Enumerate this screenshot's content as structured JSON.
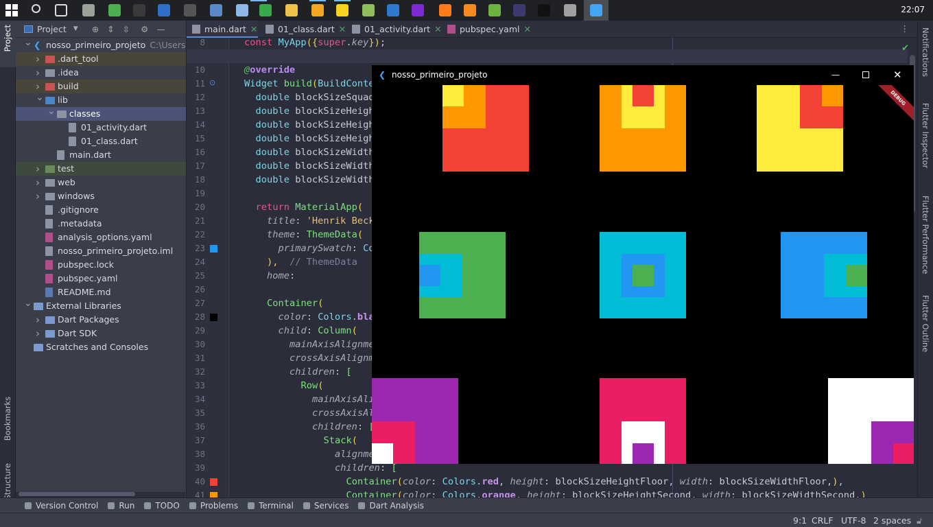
{
  "taskbar": {
    "clock": "22:07",
    "icons": [
      {
        "name": "windows-start-icon",
        "color": "#ffffff"
      },
      {
        "name": "search-icon",
        "color": "#dddddd"
      },
      {
        "name": "task-view-icon",
        "color": "#dddddd"
      },
      {
        "name": "recycle-bin-icon",
        "color": "#9aa29a"
      },
      {
        "name": "git-icon",
        "color": "#4caf50"
      },
      {
        "name": "cmd-icon",
        "color": "#3a3a3a"
      },
      {
        "name": "powershell-icon",
        "color": "#2f6fc7"
      },
      {
        "name": "terminal-icon",
        "color": "#555555"
      },
      {
        "name": "virtualbox-icon",
        "color": "#5a88c8"
      },
      {
        "name": "app-icon",
        "color": "#8fb7e8"
      },
      {
        "name": "cheat-engine-icon",
        "color": "#3ba84a"
      },
      {
        "name": "file-explorer-icon",
        "color": "#f0c24a"
      },
      {
        "name": "folder-icon",
        "color": "#f5a623"
      },
      {
        "name": "sticky-notes-icon",
        "color": "#f7d21e"
      },
      {
        "name": "app-green-icon",
        "color": "#8fbf5a"
      },
      {
        "name": "thunderbird-icon",
        "color": "#2e7ad1"
      },
      {
        "name": "app-purple-icon",
        "color": "#7b2ad4"
      },
      {
        "name": "firefox-icon",
        "color": "#ff7a18"
      },
      {
        "name": "app-orange-icon",
        "color": "#f58a1f"
      },
      {
        "name": "spring-icon",
        "color": "#6db33f"
      },
      {
        "name": "eclipse-icon",
        "color": "#3c3a6e"
      },
      {
        "name": "intellij-icon",
        "color": "#111111"
      },
      {
        "name": "usb-icon",
        "color": "#a0a0a0"
      },
      {
        "name": "flutter-icon",
        "color": "#42a5f5"
      }
    ]
  },
  "left_strip": {
    "project": "Project",
    "bookmarks": "Bookmarks",
    "structure": "Structure"
  },
  "right_strip": {
    "notifications": "Notifications",
    "inspector": "Flutter Inspector",
    "performance": "Flutter Performance",
    "outline": "Flutter Outline"
  },
  "project_panel": {
    "title": "Project",
    "tree": [
      {
        "label": "nosso_primeiro_projeto",
        "path": "C:\\Users\\F",
        "level": 0,
        "arrow": "open",
        "icon": "flutter",
        "color": "#42a5f5"
      },
      {
        "label": ".dart_tool",
        "level": 1,
        "arrow": "closed",
        "icon": "folder",
        "color": "#c75450",
        "bg": "#4a4539"
      },
      {
        "label": ".idea",
        "level": 1,
        "arrow": "closed",
        "icon": "folder",
        "color": "#8e93a1"
      },
      {
        "label": "build",
        "level": 1,
        "arrow": "closed",
        "icon": "folder",
        "color": "#c75450",
        "bg": "#4a4539"
      },
      {
        "label": "lib",
        "level": 1,
        "arrow": "open",
        "icon": "folder",
        "color": "#4a86c8"
      },
      {
        "label": "classes",
        "level": 2,
        "arrow": "open",
        "icon": "folder",
        "color": "#8e93a1",
        "bg": "#4b5478",
        "bold": true
      },
      {
        "label": "01_activity.dart",
        "level": 3,
        "icon": "file",
        "color": "#8e93a1"
      },
      {
        "label": "01_class.dart",
        "level": 3,
        "icon": "file",
        "color": "#8e93a1"
      },
      {
        "label": "main.dart",
        "level": 2,
        "icon": "file",
        "color": "#8e93a1"
      },
      {
        "label": "test",
        "level": 1,
        "arrow": "closed",
        "icon": "folder",
        "color": "#6a8a5a",
        "bg": "#3d4a3c"
      },
      {
        "label": "web",
        "level": 1,
        "arrow": "closed",
        "icon": "folder",
        "color": "#8e93a1"
      },
      {
        "label": "windows",
        "level": 1,
        "arrow": "closed",
        "icon": "folder",
        "color": "#8e93a1"
      },
      {
        "label": ".gitignore",
        "level": 1,
        "icon": "file",
        "color": "#8e93a1"
      },
      {
        "label": ".metadata",
        "level": 1,
        "icon": "file",
        "color": "#8e93a1"
      },
      {
        "label": "analysis_options.yaml",
        "level": 1,
        "icon": "file",
        "color": "#b0508a"
      },
      {
        "label": "nosso_primeiro_projeto.iml",
        "level": 1,
        "icon": "file",
        "color": "#8e93a1"
      },
      {
        "label": "pubspec.lock",
        "level": 1,
        "icon": "file",
        "color": "#b0508a"
      },
      {
        "label": "pubspec.yaml",
        "level": 1,
        "icon": "file",
        "color": "#b0508a"
      },
      {
        "label": "README.md",
        "level": 1,
        "icon": "file",
        "color": "#5a7ab0"
      },
      {
        "label": "External Libraries",
        "level": 0,
        "arrow": "open",
        "icon": "library",
        "color": "#7a9ad0"
      },
      {
        "label": "Dart Packages",
        "level": 1,
        "arrow": "closed",
        "icon": "library",
        "color": "#7a9ad0"
      },
      {
        "label": "Dart SDK",
        "level": 1,
        "arrow": "closed",
        "icon": "library",
        "color": "#7a9ad0"
      },
      {
        "label": "Scratches and Consoles",
        "level": 0,
        "icon": "scratch",
        "color": "#7a9ad0"
      }
    ]
  },
  "editor": {
    "tabs": [
      {
        "label": "main.dart",
        "active": true
      },
      {
        "label": "01_class.dart"
      },
      {
        "label": "01_activity.dart"
      },
      {
        "label": "pubspec.yaml"
      }
    ],
    "current_line": 9,
    "gutter_markers": {
      "23": "#2196f3",
      "28": "#000000",
      "40": "#f44336",
      "41": "#ff9800"
    },
    "lines": [
      {
        "n": 8,
        "indent": 0,
        "tokens": [
          [
            "const ",
            "kw"
          ],
          [
            "MyApp",
            "ty"
          ],
          [
            "({",
            "br"
          ],
          [
            "super",
            "kw"
          ],
          [
            ".",
            "plain"
          ],
          [
            "key",
            "prop"
          ],
          [
            "})",
            "br"
          ],
          [
            ";",
            "plain"
          ]
        ]
      },
      {
        "n": 9,
        "indent": 0,
        "tokens": []
      },
      {
        "n": 10,
        "indent": 0,
        "tokens": [
          [
            "@",
            "at"
          ],
          [
            "override",
            "ann"
          ]
        ]
      },
      {
        "n": 11,
        "indent": 0,
        "tokens": [
          [
            "Widget ",
            "ty"
          ],
          [
            "build",
            "fn"
          ],
          [
            "(",
            "br"
          ],
          [
            "BuildConte",
            "ty"
          ]
        ]
      },
      {
        "n": 12,
        "indent": 2,
        "tokens": [
          [
            "double ",
            "ty"
          ],
          [
            "blockSizeSquad",
            "plain"
          ]
        ]
      },
      {
        "n": 13,
        "indent": 2,
        "tokens": [
          [
            "double ",
            "ty"
          ],
          [
            "blockSizeHeigh",
            "plain"
          ]
        ]
      },
      {
        "n": 14,
        "indent": 2,
        "tokens": [
          [
            "double ",
            "ty"
          ],
          [
            "blockSizeHeigh",
            "plain"
          ]
        ]
      },
      {
        "n": 15,
        "indent": 2,
        "tokens": [
          [
            "double ",
            "ty"
          ],
          [
            "blockSizeHeigh",
            "plain"
          ]
        ]
      },
      {
        "n": 16,
        "indent": 2,
        "tokens": [
          [
            "double ",
            "ty"
          ],
          [
            "blockSizeWidth",
            "plain"
          ]
        ]
      },
      {
        "n": 17,
        "indent": 2,
        "tokens": [
          [
            "double ",
            "ty"
          ],
          [
            "blockSizeWidth",
            "plain"
          ]
        ]
      },
      {
        "n": 18,
        "indent": 2,
        "tokens": [
          [
            "double ",
            "ty"
          ],
          [
            "blockSizeWidth",
            "plain"
          ]
        ]
      },
      {
        "n": 19,
        "indent": 0,
        "tokens": []
      },
      {
        "n": 20,
        "indent": 2,
        "tokens": [
          [
            "return ",
            "kw"
          ],
          [
            "MaterialApp",
            "fn"
          ],
          [
            "(",
            "br"
          ]
        ]
      },
      {
        "n": 21,
        "indent": 4,
        "tokens": [
          [
            "title",
            "prop"
          ],
          [
            ": ",
            "plain"
          ],
          [
            "'Henrik Beck",
            "str"
          ]
        ]
      },
      {
        "n": 22,
        "indent": 4,
        "tokens": [
          [
            "theme",
            "prop"
          ],
          [
            ": ",
            "plain"
          ],
          [
            "ThemeData",
            "fn"
          ],
          [
            "(",
            "br"
          ]
        ]
      },
      {
        "n": 23,
        "indent": 6,
        "tokens": [
          [
            "primarySwatch",
            "prop"
          ],
          [
            ": ",
            "plain"
          ],
          [
            "Co",
            "ty"
          ]
        ]
      },
      {
        "n": 24,
        "indent": 4,
        "tokens": [
          [
            "),",
            "br"
          ],
          [
            "  // ThemeData",
            "cm"
          ]
        ]
      },
      {
        "n": 25,
        "indent": 4,
        "tokens": [
          [
            "home",
            "prop"
          ],
          [
            ":",
            "plain"
          ]
        ]
      },
      {
        "n": 26,
        "indent": 0,
        "tokens": []
      },
      {
        "n": 27,
        "indent": 4,
        "tokens": [
          [
            "Container",
            "fn"
          ],
          [
            "(",
            "br"
          ]
        ]
      },
      {
        "n": 28,
        "indent": 6,
        "tokens": [
          [
            "color",
            "prop"
          ],
          [
            ": ",
            "plain"
          ],
          [
            "Colors",
            "ty"
          ],
          [
            ".",
            "plain"
          ],
          [
            "bla",
            "const"
          ]
        ]
      },
      {
        "n": 29,
        "indent": 6,
        "tokens": [
          [
            "child",
            "prop"
          ],
          [
            ": ",
            "plain"
          ],
          [
            "Column",
            "fn"
          ],
          [
            "(",
            "br"
          ]
        ]
      },
      {
        "n": 30,
        "indent": 8,
        "tokens": [
          [
            "mainAxisAlignme",
            "prop"
          ]
        ]
      },
      {
        "n": 31,
        "indent": 8,
        "tokens": [
          [
            "crossAxisAlignm",
            "prop"
          ]
        ]
      },
      {
        "n": 32,
        "indent": 8,
        "tokens": [
          [
            "children",
            "prop"
          ],
          [
            ": ",
            "plain"
          ],
          [
            "[",
            "fn"
          ]
        ]
      },
      {
        "n": 33,
        "indent": 10,
        "tokens": [
          [
            "Row",
            "fn"
          ],
          [
            "(",
            "br"
          ]
        ]
      },
      {
        "n": 34,
        "indent": 12,
        "tokens": [
          [
            "mainAxisAli",
            "prop"
          ]
        ]
      },
      {
        "n": 35,
        "indent": 12,
        "tokens": [
          [
            "crossAxisAl",
            "prop"
          ]
        ]
      },
      {
        "n": 36,
        "indent": 12,
        "tokens": [
          [
            "children",
            "prop"
          ],
          [
            ": ",
            "plain"
          ],
          [
            "[",
            "fn"
          ]
        ]
      },
      {
        "n": 37,
        "indent": 14,
        "tokens": [
          [
            "Stack",
            "fn"
          ],
          [
            "(",
            "br"
          ]
        ]
      },
      {
        "n": 38,
        "indent": 16,
        "tokens": [
          [
            "alignme",
            "prop"
          ]
        ]
      },
      {
        "n": 39,
        "indent": 16,
        "tokens": [
          [
            "children",
            "prop"
          ],
          [
            ": ",
            "plain"
          ],
          [
            "[",
            "fn"
          ]
        ]
      },
      {
        "n": 40,
        "indent": 18,
        "tokens": [
          [
            "Container",
            "fn"
          ],
          [
            "(",
            "br"
          ],
          [
            "color",
            "prop"
          ],
          [
            ": ",
            "plain"
          ],
          [
            "Colors",
            "ty"
          ],
          [
            ".",
            "plain"
          ],
          [
            "red",
            "const"
          ],
          [
            ", ",
            "plain"
          ],
          [
            "height",
            "prop"
          ],
          [
            ": blockSizeHeightFloor, ",
            "plain"
          ],
          [
            "width",
            "prop"
          ],
          [
            ": blockSizeWidthFloor,",
            "plain"
          ],
          [
            ")",
            "br"
          ],
          [
            ",",
            "plain"
          ]
        ]
      },
      {
        "n": 41,
        "indent": 18,
        "tokens": [
          [
            "Container",
            "fn"
          ],
          [
            "(",
            "br"
          ],
          [
            "color",
            "prop"
          ],
          [
            ": ",
            "plain"
          ],
          [
            "Colors",
            "ty"
          ],
          [
            ".",
            "plain"
          ],
          [
            "orange",
            "const"
          ],
          [
            ", ",
            "plain"
          ],
          [
            "height",
            "prop"
          ],
          [
            ": blockSizeHeightSecond, ",
            "plain"
          ],
          [
            "width",
            "prop"
          ],
          [
            ": blockSizeWidthSecond,",
            "plain"
          ],
          [
            ")",
            "br"
          ]
        ]
      }
    ]
  },
  "flutter_window": {
    "title": "nosso_primeiro_projeto",
    "debug_banner": "DEBUG",
    "palette": {
      "red": "#f44336",
      "orange": "#ff9800",
      "yellow": "#ffeb3b",
      "green": "#4caf50",
      "cyan": "#00bcd4",
      "blue": "#2196f3",
      "purple": "#9c27b0",
      "pink": "#e91e63",
      "white": "#ffffff"
    },
    "rows": [
      [
        [
          "red",
          "orange",
          "yellow"
        ],
        [
          "orange",
          "yellow",
          "red"
        ],
        [
          "yellow",
          "red",
          "orange"
        ]
      ],
      [
        [
          "green",
          "cyan",
          "blue"
        ],
        [
          "cyan",
          "blue",
          "green"
        ],
        [
          "blue",
          "cyan",
          "green"
        ]
      ],
      [
        [
          "purple",
          "pink",
          "white"
        ],
        [
          "pink",
          "white",
          "purple"
        ],
        [
          "white",
          "purple",
          "pink"
        ]
      ]
    ]
  },
  "bottom_toolbar": [
    "Version Control",
    "Run",
    "TODO",
    "Problems",
    "Terminal",
    "Services",
    "Dart Analysis"
  ],
  "status_bar": {
    "position": "9:1",
    "line_ending": "CRLF",
    "encoding": "UTF-8",
    "indent": "2 spaces"
  }
}
